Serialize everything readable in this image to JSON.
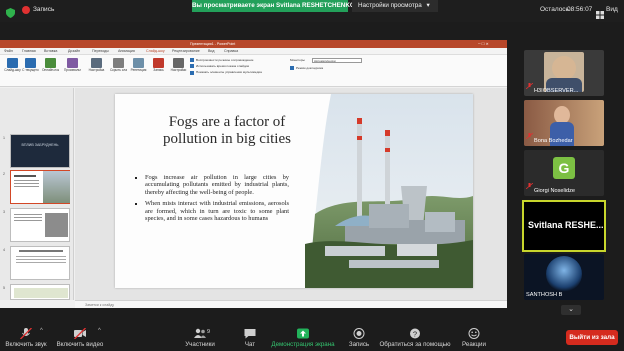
{
  "topbar": {
    "record_label": "Запись",
    "share_banner": "Вы просматриваете экран Svitlana RESHETCHENKO",
    "view_options": "Настройки просмотра",
    "remaining_label": "Осталось:",
    "remaining_time": "08:56:07",
    "view_label": "Вид"
  },
  "powerpoint": {
    "title": "Презентация1 - PowerPoint",
    "tabs": [
      "Файл",
      "Главная",
      "Вставка",
      "Дизайн",
      "Переходы",
      "Анимация",
      "Слайд-шоу",
      "Рецензирование",
      "Вид",
      "Справка"
    ],
    "ribbon_items": [
      "Слайд-шоу",
      "С текущего",
      "Онлайн-показ",
      "Произвольный",
      "Настройка",
      "Скрыть слайд",
      "Репетиция",
      "Запись",
      "Настройки"
    ],
    "ribbon_checks": [
      "Воспроизвести речевое сопровождение",
      "Использовать время показа слайдов",
      "Показать элементы управления мультимедиа"
    ],
    "monitor_label": "Мониторы",
    "monitor_select": "Автоматически",
    "presenter_view": "Режим докладчика",
    "notes_placeholder": "Заметки к слайду",
    "thumb_title": "ВПЛИВ ЗАБРУДНЕНЬ",
    "slide": {
      "title": "Fogs are a factor of pollution in big cities",
      "bullets": [
        "Fogs increase air pollution in large cities by accumulating pollutants emitted by industrial plants, thereby affecting the well-being of people.",
        "When mists interact with industrial emissions, aerosols are formed, which in turn are toxic to some plant species, and in some cases hazardous to humans"
      ]
    }
  },
  "participants": [
    {
      "name": "H3IOBSERVER..."
    },
    {
      "name": "Bona Bozhedar"
    },
    {
      "name": "Giorgi Noselidze",
      "initial": "G"
    },
    {
      "name": "Svitlana RESHE..."
    },
    {
      "name": "SANTHOSH B"
    }
  ],
  "toolbar": {
    "audio": "Включить звук",
    "video": "Включить видео",
    "participants": "Участники",
    "participants_count": "9",
    "chat": "Чат",
    "share": "Демонстрация экрана",
    "record": "Запись",
    "help": "Обратиться за помощью",
    "reactions": "Реакции",
    "leave": "Выйти из зала"
  },
  "colors": {
    "share_green": "#23a05a",
    "leave_red": "#d52b1e",
    "active_border": "#c8d62c",
    "ppt_red": "#b7472a"
  }
}
